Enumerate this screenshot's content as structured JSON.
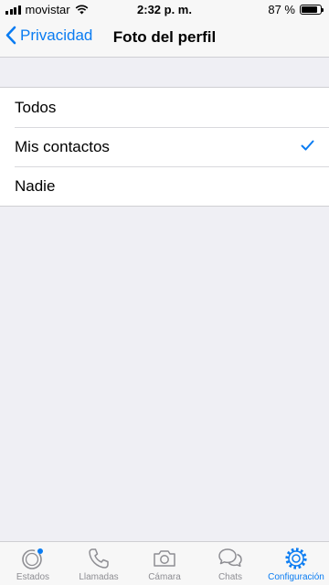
{
  "status_bar": {
    "carrier": "movistar",
    "time": "2:32 p. m.",
    "battery_percent": "87 %",
    "battery_level": 0.87
  },
  "nav": {
    "back_label": "Privacidad",
    "title": "Foto del perfil"
  },
  "options": [
    {
      "label": "Todos",
      "selected": false
    },
    {
      "label": "Mis contactos",
      "selected": true
    },
    {
      "label": "Nadie",
      "selected": false
    }
  ],
  "tabs": [
    {
      "label": "Estados",
      "icon": "status-icon",
      "active": false
    },
    {
      "label": "Llamadas",
      "icon": "phone-icon",
      "active": false
    },
    {
      "label": "Cámara",
      "icon": "camera-icon",
      "active": false
    },
    {
      "label": "Chats",
      "icon": "chats-icon",
      "active": false
    },
    {
      "label": "Configuración",
      "icon": "settings-icon",
      "active": true
    }
  ],
  "colors": {
    "accent": "#0a7cf2",
    "inactive": "#8e8e93",
    "background": "#efeff4"
  }
}
